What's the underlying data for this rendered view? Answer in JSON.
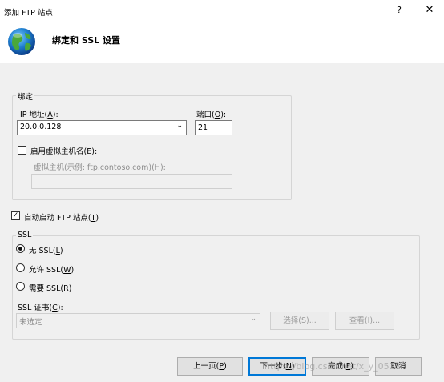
{
  "window": {
    "title": "添加 FTP 站点",
    "help": "?",
    "close": "✕"
  },
  "header": {
    "title": "绑定和 SSL 设置"
  },
  "binding": {
    "group_label": "绑定",
    "ip_label": "IP 地址(",
    "ip_key": "A",
    "ip_label_end": "):",
    "ip_value": "20.0.0.128",
    "port_label": "端口(",
    "port_key": "O",
    "port_label_end": "):",
    "port_value": "21",
    "virtual_host_check": {
      "label": "启用虚拟主机名(",
      "key": "E",
      "label_end": "):",
      "checked": false
    },
    "virtual_host_label": "虚拟主机(示例: ftp.contoso.com)(",
    "virtual_host_key": "H",
    "virtual_host_label_end": "):",
    "virtual_host_value": ""
  },
  "autostart": {
    "label": "自动启动 FTP 站点(",
    "key": "T",
    "label_end": ")",
    "checked": true
  },
  "ssl": {
    "group_label": "SSL",
    "options": [
      {
        "label": "无 SSL(",
        "key": "L",
        "end": ")",
        "selected": true
      },
      {
        "label": "允许 SSL(",
        "key": "W",
        "end": ")",
        "selected": false
      },
      {
        "label": "需要 SSL(",
        "key": "R",
        "end": ")",
        "selected": false
      }
    ],
    "cert_label": "SSL 证书(",
    "cert_key": "C",
    "cert_label_end": "):",
    "cert_value": "未选定",
    "select_btn": {
      "label": "选择(",
      "key": "S",
      "end": ")..."
    },
    "view_btn": {
      "label": "查看(",
      "key": "I",
      "end": ")..."
    }
  },
  "footer": {
    "prev": {
      "label": "上一页(",
      "key": "P",
      "end": ")"
    },
    "next": {
      "label": "下一步(",
      "key": "N",
      "end": ")"
    },
    "finish": {
      "label": "完成(",
      "key": "F",
      "end": ")"
    },
    "cancel": "取消"
  },
  "watermark": "https://blog.csdn.net/x_y_0528"
}
